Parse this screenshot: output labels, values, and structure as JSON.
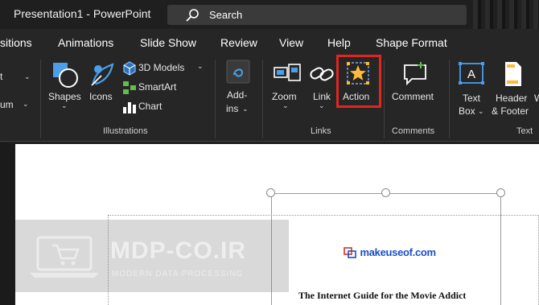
{
  "titlebar": {
    "title": "Presentation1  -  PowerPoint",
    "search_label": "Search"
  },
  "tabs": [
    {
      "label": "sitions"
    },
    {
      "label": "Animations"
    },
    {
      "label": "Slide Show"
    },
    {
      "label": "Review"
    },
    {
      "label": "View"
    },
    {
      "label": "Help"
    },
    {
      "label": "Shape Format"
    }
  ],
  "ribbon": {
    "partial_left": {
      "t": "t",
      "um": "um"
    },
    "illustrations": {
      "shapes": "Shapes",
      "icons": "Icons",
      "models": "3D Models",
      "smartart": "SmartArt",
      "chart": "Chart",
      "group": "Illustrations"
    },
    "addins": {
      "line1": "Add-",
      "line2": "ins"
    },
    "links": {
      "zoom": "Zoom",
      "link": "Link",
      "action": "Action",
      "group": "Links"
    },
    "comments": {
      "comment": "Comment",
      "group": "Comments"
    },
    "text": {
      "textbox1": "Text",
      "textbox2": "Box",
      "header1": "Header",
      "header2": "& Footer",
      "group": "Text"
    }
  },
  "slide": {
    "logo_text": "makeuseof.com",
    "heading": "The Internet Guide for the Movie Addict"
  },
  "watermark": {
    "title": "MDP-CO.IR",
    "subtitle": "MODERN DATA PROCESSING"
  },
  "colors": {
    "highlight": "#e0261f",
    "accent_blue": "#4a9fe8",
    "comment_green": "#5fbf4a"
  }
}
